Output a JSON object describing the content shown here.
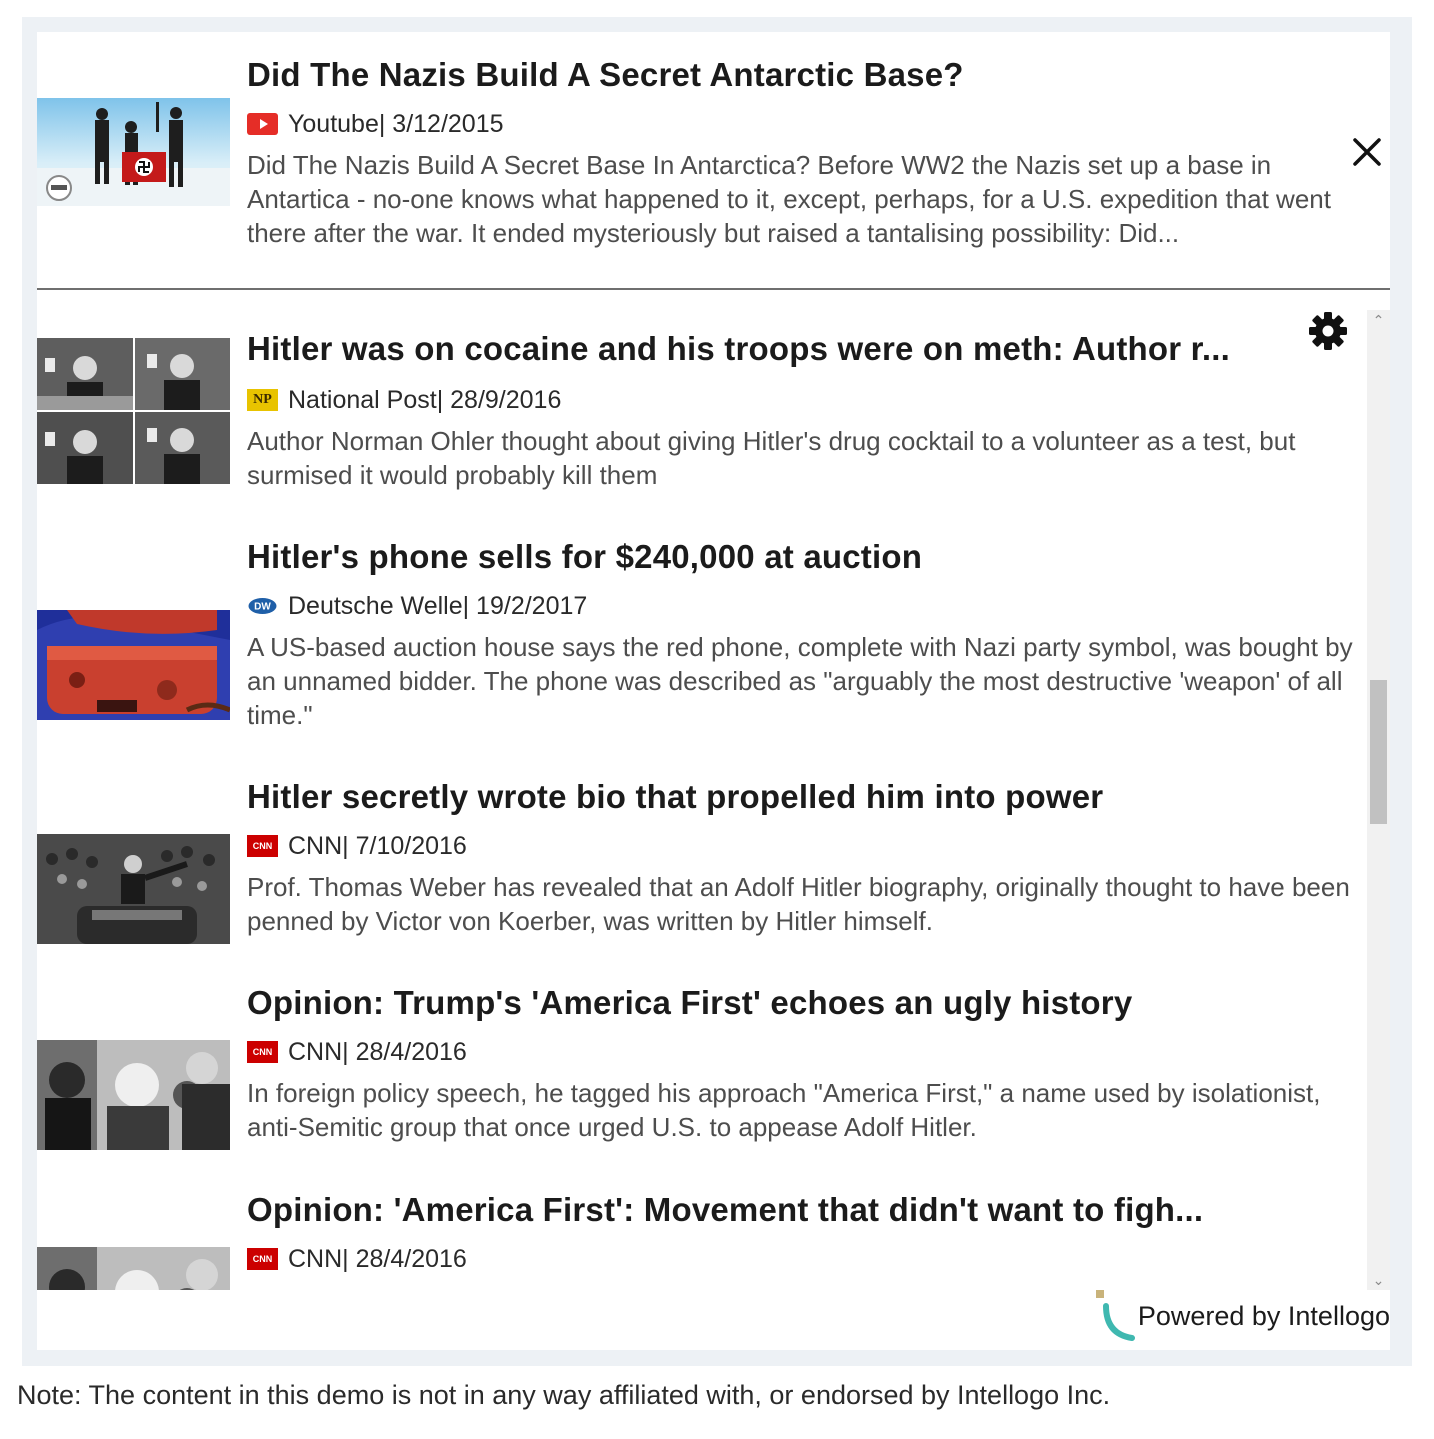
{
  "featured": {
    "title": "Did The Nazis Build A Secret Antarctic Base?",
    "source": "Youtube| 3/12/2015",
    "source_icon": "youtube-logo",
    "description": "Did The Nazis Build A Secret Base In Antarctica? Before WW2 the Nazis set up a base in Antartica - no-one knows what happened to it, except, perhaps, for a U.S. expedition that went there after the war. It ended mysteriously but raised a tantalising possibility: Did..."
  },
  "articles": [
    {
      "title": "Hitler was on cocaine and his troops were on meth: Author r...",
      "source": "National Post| 28/9/2016",
      "source_icon": "np-logo",
      "logo_text": "NP",
      "description": "Author Norman Ohler thought about giving Hitler's drug cocktail to a volunteer as a test, but surmised it would probably kill them"
    },
    {
      "title": "Hitler's phone sells for $240,000 at auction",
      "source": "Deutsche Welle| 19/2/2017",
      "source_icon": "dw-logo",
      "logo_text": "DW",
      "description": "A US-based auction house says the red phone, complete with Nazi party symbol, was bought by an unnamed bidder. The phone was described as \"arguably the most destructive 'weapon' of all time.\""
    },
    {
      "title": "Hitler secretly wrote bio that propelled him into power",
      "source": "CNN| 7/10/2016",
      "source_icon": "cnn-logo",
      "logo_text": "CNN",
      "description": "Prof. Thomas Weber has revealed that an Adolf Hitler biography, originally thought to have been penned by Victor von Koerber, was written by Hitler himself."
    },
    {
      "title": "Opinion: Trump's 'America First' echoes an ugly history",
      "source": "CNN| 28/4/2016",
      "source_icon": "cnn-logo",
      "logo_text": "CNN",
      "description": "In foreign policy speech, he tagged his approach \"America First,\" a name used by isolationist, anti-Semitic group that once urged U.S. to appease Adolf Hitler."
    },
    {
      "title": "Opinion: 'America First': Movement that didn't want to figh...",
      "source": "CNN| 28/4/2016",
      "source_icon": "cnn-logo",
      "logo_text": "CNN",
      "description": ""
    }
  ],
  "footer": {
    "powered_by": "Powered by Intellogo"
  },
  "note": "Note: The content in this demo is not in any way affiliated with, or endorsed by Intellogo Inc.",
  "colors": {
    "youtube": "#e52d27",
    "cnn": "#cc0000",
    "np": "#e8c300",
    "dw": "#1f5fa8",
    "intellogo_teal": "#3fb8b0"
  }
}
